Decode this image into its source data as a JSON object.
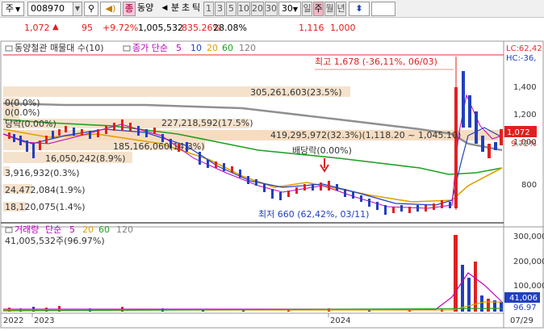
{
  "toolbar": {
    "market": "주",
    "code": "008970",
    "name": "동양",
    "tabs": [
      "분",
      "초",
      "틱",
      "1",
      "3",
      "5",
      "10",
      "20",
      "30"
    ],
    "period_value": "30",
    "periods": [
      "일",
      "주",
      "월",
      "년"
    ],
    "active_period": "주",
    "icons": [
      "search-icon",
      "speaker-icon",
      "info-icon",
      "arrow-left-icon",
      "updown-icon"
    ]
  },
  "quote": {
    "price": "1,072",
    "change": "95",
    "change_pct": "+9.72%",
    "volume": "1,005,532",
    "vol_ratio": "835.26%",
    "turnover": "28.08%",
    "prev_price": "1,116",
    "base": "1,000"
  },
  "chart": {
    "legend_main": "동양철관 매물대 수(10)",
    "legend_ma": {
      "label": "종가 단순",
      "periods": [
        "5",
        "10",
        "20",
        "60",
        "120"
      ],
      "colors": [
        "#c000c0",
        "#2040c0",
        "#e0a000",
        "#20a020",
        "#808080"
      ]
    },
    "right_top1": "LC:62,42",
    "right_top2": "HC:-36,",
    "price_ticks": [
      "1,400",
      "1,200",
      "1,000",
      "800"
    ],
    "current_price_tag": "1,072",
    "current_pct_tag": "9.72%",
    "high_label": "최고 1,678 (-36,11%, 06/03)",
    "low_label": "최저 660 (62,42%, 03/11)",
    "dividend_label": "배당락(0.00%)",
    "dividend_label2": "당락(0.00%)",
    "volume_profile": [
      {
        "label": "305,261,603(23.5%)"
      },
      {
        "label": "0(0.0%)"
      },
      {
        "label": "0(0.0%)"
      },
      {
        "label": "227,218,592(17.5%)"
      },
      {
        "label": "419,295,972(32.3%)(1,118.20 ~ 1,045.10)"
      },
      {
        "label": "185,166,060(14.3%)"
      },
      {
        "label": "16,050,242(8.9%)"
      },
      {
        "label": "3,916,932(0.3%)"
      },
      {
        "label": "24,472,084(1.9%)"
      },
      {
        "label": "18,120,075(1.4%)"
      }
    ],
    "volume_legend": {
      "label": "거래량",
      "ma_label": "단순",
      "periods": [
        "5",
        "20",
        "60",
        "120"
      ]
    },
    "volume_value": "41,005,532주(96.97%)",
    "volume_ticks": [
      "300,000",
      "200,000",
      "100,000"
    ],
    "volume_tag": "41,006",
    "volume_pct_tag": "96.97",
    "x_labels": [
      "2022",
      "2023",
      "2024",
      "07/29"
    ]
  }
}
